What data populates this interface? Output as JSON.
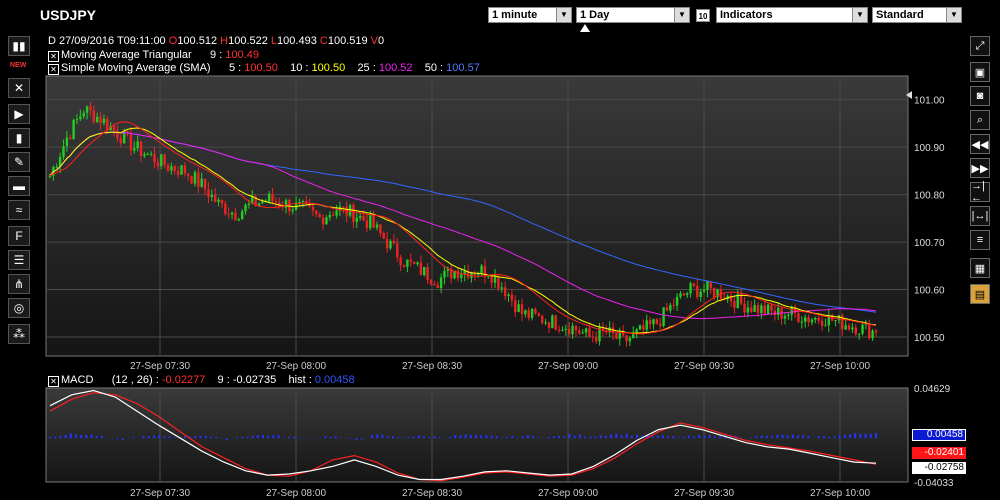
{
  "header": {
    "symbol": "USDJPY",
    "interval": "1 minute",
    "period": "1 Day",
    "period_days": "10",
    "indicators": "Indicators",
    "style": "Standard"
  },
  "toolbar_left": {
    "new_label": "NEW"
  },
  "ohlc": {
    "date_label": "D",
    "date": "27/09/2016",
    "time_label": "T",
    "time": "09:11:00",
    "open_label": "O",
    "open": "100.512",
    "high_label": "H",
    "high": "100.522",
    "low_label": "L",
    "low": "100.493",
    "close_label": "C",
    "close": "100.519",
    "vol_label": "V",
    "vol": "0"
  },
  "legend": {
    "mat_name": "Moving Average Triangular",
    "mat_param": "9 :",
    "mat_value": "100.49",
    "sma_name": "Simple Moving Average (SMA)",
    "sma5_param": "5 :",
    "sma5_value": "100.50",
    "sma10_param": "10 :",
    "sma10_value": "100.50",
    "sma25_param": "25 :",
    "sma25_value": "100.52",
    "sma50_param": "50 :",
    "sma50_value": "100.57"
  },
  "macd_legend": {
    "name": "MACD",
    "params": "(12 , 26) :",
    "macd_value": "-0.02277",
    "signal_param": "9 :",
    "signal_value": "-0.02735",
    "hist_label": "hist :",
    "hist_value": "0.00458"
  },
  "macd_axis": {
    "top": "0.04629",
    "bottom": "-0.04033",
    "tag_hist": "0.00458",
    "tag_macd": "-0.02401",
    "tag_signal": "-0.02758"
  },
  "colors": {
    "up": "#22cc22",
    "down": "#ee2222",
    "mat": "#ff2020",
    "sma5": "#ff2020",
    "sma10": "#ffff00",
    "sma25": "#ee22ee",
    "sma50": "#3366ff",
    "macd": "#ffffff",
    "signal": "#ff2020",
    "hist": "#2233ff"
  },
  "chart_data": [
    {
      "type": "candlestick",
      "title": "USDJPY",
      "x_ticks": [
        "27-Sep 07:30",
        "27-Sep 08:00",
        "27-Sep 08:30",
        "27-Sep 09:00",
        "27-Sep 09:30",
        "27-Sep 10:00"
      ],
      "y_ticks": [
        "101.00",
        "100.90",
        "100.80",
        "100.70",
        "100.60",
        "100.50"
      ],
      "ylim": [
        100.46,
        101.05
      ],
      "series_close": [
        100.84,
        100.92,
        100.98,
        100.96,
        100.93,
        100.9,
        100.88,
        100.86,
        100.85,
        100.82,
        100.78,
        100.76,
        100.78,
        100.79,
        100.78,
        100.77,
        100.75,
        100.77,
        100.76,
        100.74,
        100.7,
        100.66,
        100.64,
        100.62,
        100.64,
        100.64,
        100.64,
        100.6,
        100.55,
        100.54,
        100.53,
        100.52,
        100.5,
        100.51,
        100.49,
        100.51,
        100.53,
        100.57,
        100.6,
        100.6,
        100.59,
        100.57,
        100.56,
        100.55,
        100.55,
        100.54,
        100.54,
        100.53,
        100.52,
        100.51
      ],
      "series": [
        {
          "name": "Moving Average Triangular 9",
          "last": 100.49
        },
        {
          "name": "SMA 5",
          "last": 100.5
        },
        {
          "name": "SMA 10",
          "last": 100.5
        },
        {
          "name": "SMA 25",
          "last": 100.52
        },
        {
          "name": "SMA 50",
          "last": 100.57
        }
      ]
    },
    {
      "type": "line",
      "title": "MACD",
      "x_ticks": [
        "27-Sep 07:30",
        "27-Sep 08:00",
        "27-Sep 08:30",
        "27-Sep 09:00",
        "27-Sep 09:30",
        "27-Sep 10:00"
      ],
      "ylim": [
        -0.04033,
        0.04629
      ],
      "macd": [
        0.03,
        0.04,
        0.044,
        0.038,
        0.025,
        0.012,
        0.0,
        -0.012,
        -0.022,
        -0.03,
        -0.034,
        -0.033,
        -0.03,
        -0.026,
        -0.02,
        -0.026,
        -0.034,
        -0.038,
        -0.038,
        -0.035,
        -0.031,
        -0.03,
        -0.032,
        -0.034,
        -0.033,
        -0.026,
        -0.015,
        -0.002,
        0.008,
        0.012,
        0.008,
        0.002,
        -0.004,
        -0.008,
        -0.01,
        -0.014,
        -0.018,
        -0.022,
        -0.023
      ],
      "signal": [
        0.025,
        0.036,
        0.042,
        0.04,
        0.032,
        0.02,
        0.006,
        -0.008,
        -0.018,
        -0.028,
        -0.034,
        -0.035,
        -0.03,
        -0.02,
        -0.016,
        -0.022,
        -0.032,
        -0.038,
        -0.039,
        -0.036,
        -0.032,
        -0.031,
        -0.033,
        -0.035,
        -0.034,
        -0.028,
        -0.018,
        -0.005,
        0.006,
        0.014,
        0.01,
        0.004,
        -0.002,
        -0.006,
        -0.009,
        -0.012,
        -0.016,
        -0.02,
        -0.024
      ],
      "hist": [
        0.002,
        0.004,
        0.003,
        -0.002,
        0.001,
        0.002,
        0.001,
        0.003,
        -0.001,
        0.002,
        0.003,
        0.001,
        0.0,
        0.002,
        -0.002,
        0.003,
        0.001,
        0.002,
        0.001,
        0.003,
        0.002,
        0.001,
        0.002,
        0.001,
        0.003,
        0.002,
        0.004,
        0.003,
        0.002,
        0.001,
        0.002,
        0.003,
        0.001,
        0.002,
        0.003,
        0.001,
        0.002,
        0.004,
        0.005
      ]
    }
  ]
}
